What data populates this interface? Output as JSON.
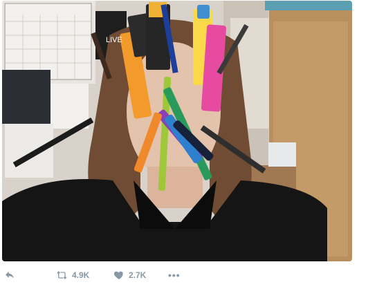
{
  "tweet": {
    "media": {
      "alt_icon": "photo-icon",
      "sticky_note_text": "LIVE"
    },
    "actions": {
      "reply": {
        "icon": "reply-icon",
        "count": ""
      },
      "retweet": {
        "icon": "retweet-icon",
        "count": "4.9K"
      },
      "like": {
        "icon": "heart-icon",
        "count": "2.7K"
      },
      "more": {
        "icon": "more-icon",
        "label": "•••"
      }
    },
    "colors": {
      "action_gray": "#8899a6",
      "background": "#ffffff"
    }
  }
}
